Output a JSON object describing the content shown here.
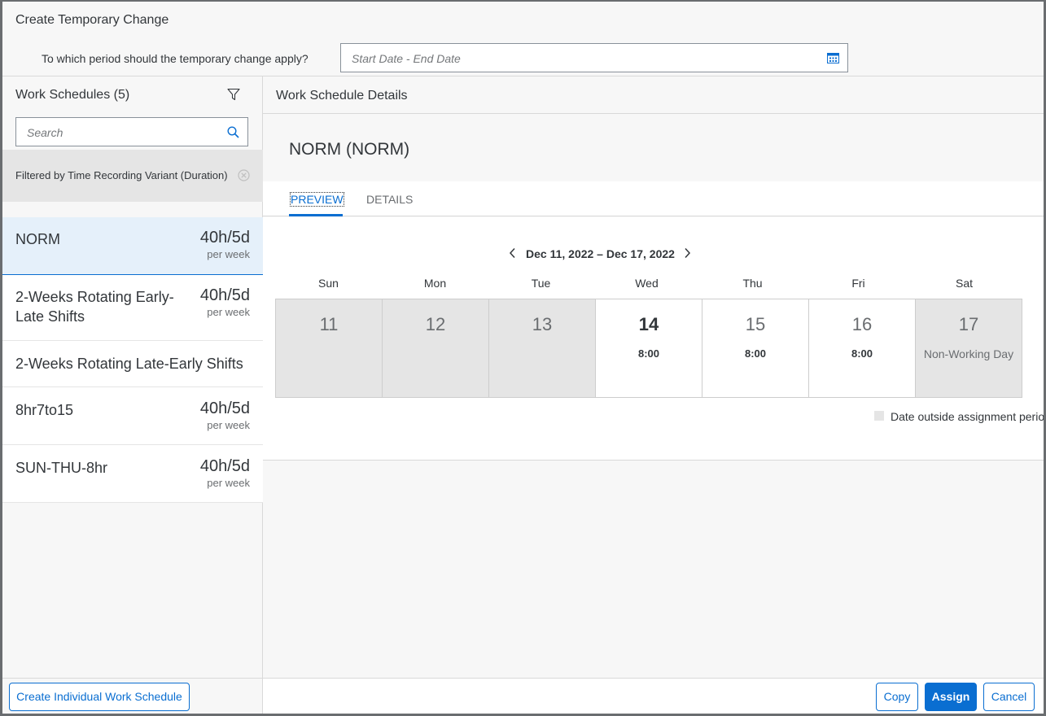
{
  "dialog": {
    "title": "Create Temporary Change",
    "period_label": "To which period should the temporary change apply?",
    "period_placeholder": "Start Date - End Date"
  },
  "list": {
    "title": "Work Schedules (5)",
    "search_placeholder": "Search",
    "filter_info": "Filtered by Time Recording Variant (Duration)",
    "items": [
      {
        "name": "NORM",
        "hours": "40h/5d",
        "per": "per week"
      },
      {
        "name": "2-Weeks Rotating Early-Late Shifts",
        "hours": "40h/5d",
        "per": "per week"
      },
      {
        "name": "2-Weeks Rotating Late-Early Shifts",
        "hours": "",
        "per": ""
      },
      {
        "name": "8hr7to15",
        "hours": "40h/5d",
        "per": "per week"
      },
      {
        "name": "SUN-THU-8hr",
        "hours": "40h/5d",
        "per": "per week"
      }
    ],
    "create_button": "Create Individual Work Schedule"
  },
  "details": {
    "title": "Work Schedule Details",
    "object_title": "NORM (NORM)",
    "tabs": [
      "PREVIEW",
      "DETAILS"
    ],
    "range": "Dec 11, 2022 – Dec 17, 2022",
    "weekdays": [
      "Sun",
      "Mon",
      "Tue",
      "Wed",
      "Thu",
      "Fri",
      "Sat"
    ],
    "days": [
      {
        "num": "11",
        "value": ""
      },
      {
        "num": "12",
        "value": ""
      },
      {
        "num": "13",
        "value": ""
      },
      {
        "num": "14",
        "value": "8:00"
      },
      {
        "num": "15",
        "value": "8:00"
      },
      {
        "num": "16",
        "value": "8:00"
      },
      {
        "num": "17",
        "value": "Non-Working Day"
      }
    ],
    "legend": "Date outside assignment period"
  },
  "footer": {
    "copy": "Copy",
    "assign": "Assign",
    "cancel": "Cancel"
  },
  "colors": {
    "accent": "#0a6ed1",
    "selected_bg": "#e5f0fa",
    "outside_period_bg": "#e5e5e5"
  }
}
